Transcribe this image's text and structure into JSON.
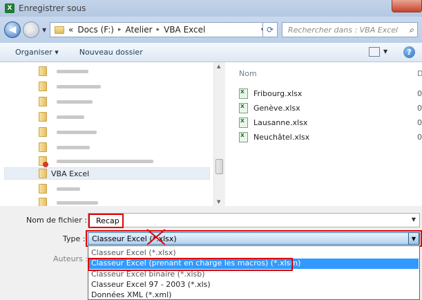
{
  "window": {
    "title": "Enregistrer sous",
    "app_icon": "excel-icon"
  },
  "address": {
    "segments": [
      "Docs (F:)",
      "Atelier",
      "VBA Excel"
    ],
    "overflow": "«",
    "search_placeholder": "Rechercher dans : VBA Excel"
  },
  "toolbar": {
    "organize_label": "Organiser ▾",
    "new_folder_label": "Nouveau dossier",
    "help_label": "?"
  },
  "nav": {
    "selected_folder": "VBA Excel"
  },
  "files": {
    "column_name": "Nom",
    "column_date": "D",
    "items": [
      {
        "name": "Fribourg.xlsx",
        "date": "0"
      },
      {
        "name": "Genève.xlsx",
        "date": "0"
      },
      {
        "name": "Lausanne.xlsx",
        "date": "0"
      },
      {
        "name": "Neuchâtel.xlsx",
        "date": "0"
      }
    ]
  },
  "form": {
    "filename_label": "Nom de fichier :",
    "filename_value": "Recap",
    "type_label": "Type :",
    "type_value": "Classeur Excel (*.xlsx)",
    "authors_label": "Auteurs :",
    "type_options": [
      "Classeur Excel (*.xlsx)",
      "Classeur Excel (prenant en charge les macros) (*.xlsm)",
      "Classeur Excel binaire (*.xlsb)",
      "Classeur Excel 97 - 2003 (*.xls)",
      "Données XML (*.xml)"
    ],
    "selected_option_index": 1
  },
  "colors": {
    "annotation_red": "#e00000",
    "highlight_blue": "#3399ff"
  }
}
